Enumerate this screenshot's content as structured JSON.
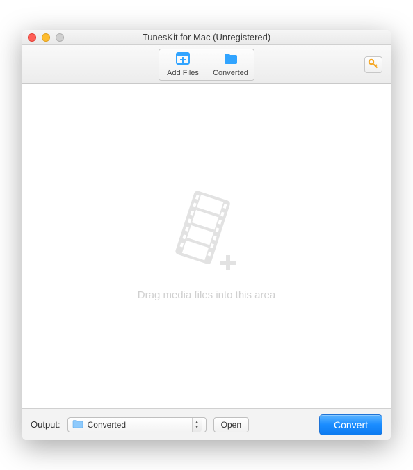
{
  "window": {
    "title": "TunesKit for Mac (Unregistered)"
  },
  "toolbar": {
    "add_files_label": "Add Files",
    "converted_label": "Converted"
  },
  "main": {
    "drag_hint": "Drag media files into this area"
  },
  "bottom": {
    "output_label": "Output:",
    "output_folder": "Converted",
    "open_label": "Open",
    "convert_label": "Convert"
  },
  "colors": {
    "accent": "#1a8cff",
    "icon_blue": "#31a4ff",
    "key_yellow": "#f5a623"
  }
}
